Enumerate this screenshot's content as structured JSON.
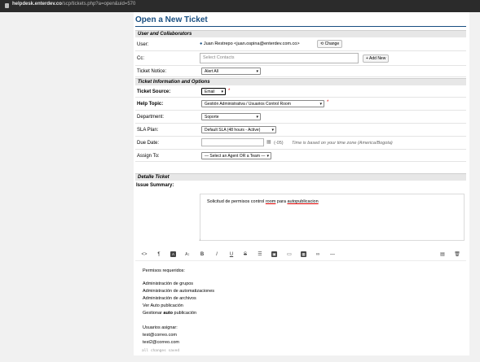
{
  "browser": {
    "url_host": "helpdesk.enterdev.co",
    "url_path": "/scp/tickets.php?a=open&uid=570"
  },
  "page": {
    "title": "Open a New Ticket"
  },
  "sections": {
    "user": "User and Collaborators",
    "ticket_info": "Ticket Information and Options",
    "details": "Detalle Ticket"
  },
  "user_row": {
    "label": "User:",
    "value": "Juan Restrepo <juan.ospina@enterdev.com.co>",
    "change_btn": "Change"
  },
  "cc_row": {
    "label": "Cc:",
    "placeholder": "Select Contacts",
    "add_btn": "+ Add New"
  },
  "notice_row": {
    "label": "Ticket Notice:",
    "value": "Alert All"
  },
  "source_row": {
    "label": "Ticket Source:",
    "value": "Email",
    "req": "*"
  },
  "topic_row": {
    "label": "Help Topic:",
    "value": "Gestión Administrativa / Usuarios Control Room",
    "req": "*"
  },
  "dept_row": {
    "label": "Department:",
    "value": "Soporte"
  },
  "sla_row": {
    "label": "SLA Plan:",
    "value": "Default SLA (48 hours - Active)"
  },
  "due_row": {
    "label": "Due Date:",
    "tz": "(-05)",
    "note": "Time is based on your time zone (America/Bogota)"
  },
  "assign_row": {
    "label": "Assign To:",
    "value": "— Select an Agent OR a Team —"
  },
  "issue": {
    "label": "Issue Summary:",
    "text_a": "Solicitud de permisos control",
    "text_b": "room",
    "text_c": "para",
    "text_d": "autopublicacion"
  },
  "toolbar_icons": [
    "code-icon",
    "paragraph-icon",
    "text-style-icon",
    "font-size-icon",
    "bold-icon",
    "italic-icon",
    "underline-icon",
    "strikethrough-icon",
    "list-icon",
    "image-icon",
    "video-icon",
    "table-icon",
    "link-icon",
    "horizontal-rule-icon",
    "save-icon",
    "trash-icon"
  ],
  "editor": {
    "lines": [
      "Permisos requeridos:",
      "Administración de grupos",
      "Administración de automatizaciones",
      "Administración de archivos",
      "Ver Auto publicación",
      "Usuarios asignar:",
      "test@correo.com",
      "test2@correo.com"
    ],
    "gestionar_a": "Gestionar",
    "gestionar_b": "auto",
    "gestionar_c": "publicación",
    "status": "all changes saved"
  }
}
